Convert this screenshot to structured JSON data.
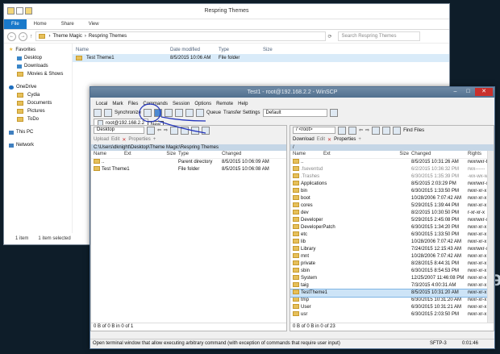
{
  "background": {
    "text_right": "ǝ"
  },
  "explorer": {
    "title": "Respring Themes",
    "tabs": [
      "File",
      "Home",
      "Share",
      "View"
    ],
    "address": {
      "parts": [
        "Theme Magic",
        "Respring Themes"
      ],
      "separator": "›"
    },
    "search_placeholder": "Search Respring Themes",
    "nav": {
      "favorites": "Favorites",
      "fav_items": [
        "Desktop",
        "Downloads",
        "Movies & Shows"
      ],
      "onedrive": "OneDrive",
      "onedrive_items": [
        "Cydia",
        "Documents",
        "Pictures",
        "ToDo"
      ],
      "thispc": "This PC",
      "network": "Network"
    },
    "columns": {
      "name": "Name",
      "date": "Date modified",
      "type": "Type",
      "size": "Size"
    },
    "rows": [
      {
        "name": "Test Theme1",
        "date": "8/5/2015 10:06 AM",
        "type": "File folder",
        "size": ""
      }
    ],
    "status": {
      "count": "1 item",
      "selected": "1 item selected"
    }
  },
  "scp": {
    "title": "Test1 - root@192.168.2.2 - WinSCP",
    "menu": [
      "Local",
      "Mark",
      "Files",
      "Commands",
      "Session",
      "Options",
      "Remote",
      "Help"
    ],
    "toolbar": {
      "sync": "Synchronize",
      "queue": "Queue",
      "transfer_label": "Transfer Settings",
      "transfer_value": "Default"
    },
    "session_tab": "root@192.168.2.2",
    "tooltip": "New",
    "left": {
      "drive": "Desktop",
      "actions": [
        "Upload",
        "Edit",
        "Properties"
      ],
      "path": "C:\\Users\\dknight\\Desktop\\Theme Magic\\Respring Themes",
      "cols": {
        "name": "Name",
        "ext": "Ext",
        "size": "Size",
        "type": "Type",
        "changed": "Changed"
      },
      "rows": [
        {
          "name": "..",
          "size": "",
          "type": "Parent directory",
          "changed": "8/5/2015  10:06:09 AM"
        },
        {
          "name": "Test Theme1",
          "size": "",
          "type": "File folder",
          "changed": "8/5/2015  10:06:08 AM"
        }
      ],
      "footer": "0 B of 0 B in 0 of 1"
    },
    "right": {
      "drive": "/ <root>",
      "actions": [
        "Download",
        "Edit",
        "Properties"
      ],
      "find": "Find Files",
      "path": "/",
      "cols": {
        "name": "Name",
        "ext": "Ext",
        "size": "Size",
        "changed": "Changed",
        "rights": "Rights"
      },
      "rows": [
        {
          "name": "..",
          "changed": "8/5/2015 10:31:26 AM",
          "rights": "rwxrwxr-t",
          "dim": false
        },
        {
          "name": ".fseventsd",
          "changed": "6/2/2015 10:36:32 PM",
          "rights": "rwx------",
          "dim": true
        },
        {
          "name": ".Trashes",
          "changed": "6/30/2015 1:35:39 PM",
          "rights": "-wx-wx-wt",
          "dim": true
        },
        {
          "name": "Applications",
          "changed": "8/5/2015 2:03:29 PM",
          "rights": "rwxrwxr-x",
          "dim": false
        },
        {
          "name": "bin",
          "changed": "6/30/2015 1:33:50 PM",
          "rights": "rwxr-xr-x",
          "dim": false
        },
        {
          "name": "boot",
          "changed": "10/28/2006 7:07:42 AM",
          "rights": "rwxr-xr-x",
          "dim": false
        },
        {
          "name": "cores",
          "changed": "5/29/2015 1:39:44 PM",
          "rights": "rwxr-xr-x",
          "dim": false
        },
        {
          "name": "dev",
          "changed": "8/2/2015 10:30:50 PM",
          "rights": "r-xr-xr-x",
          "dim": false
        },
        {
          "name": "Developer",
          "changed": "5/29/2015 2:45:08 PM",
          "rights": "rwxrwxr-x",
          "dim": false
        },
        {
          "name": "DeveloperPatch",
          "changed": "6/30/2015 1:34:20 PM",
          "rights": "rwxr-xr-x",
          "dim": false
        },
        {
          "name": "etc",
          "changed": "6/30/2015 1:33:50 PM",
          "rights": "rwxr-xr-x",
          "dim": false
        },
        {
          "name": "lib",
          "changed": "10/28/2006 7:07:42 AM",
          "rights": "rwxr-xr-x",
          "dim": false
        },
        {
          "name": "Library",
          "changed": "7/24/2015 12:15:43 AM",
          "rights": "rwxrwxr-x",
          "dim": false
        },
        {
          "name": "mnt",
          "changed": "10/28/2006 7:07:42 AM",
          "rights": "rwxr-xr-x",
          "dim": false
        },
        {
          "name": "private",
          "changed": "8/28/2015 8:44:31 PM",
          "rights": "rwxr-xr-x",
          "dim": false
        },
        {
          "name": "sbin",
          "changed": "6/30/2015 8:54:53 PM",
          "rights": "rwxr-xr-x",
          "dim": false
        },
        {
          "name": "System",
          "changed": "12/25/2007 11:46:08 PM",
          "rights": "rwxr-xr-x",
          "dim": false
        },
        {
          "name": "taig",
          "changed": "7/3/2015 4:00:31 AM",
          "rights": "rwxr-xr-x",
          "dim": false
        },
        {
          "name": "TestTheme1",
          "changed": "8/5/2015 10:31:20 AM",
          "rights": "rwxr-xr-x",
          "dim": false,
          "highlight": true
        },
        {
          "name": "tmp",
          "changed": "6/30/2015 10:31:20 AM",
          "rights": "rwxr-xr-x",
          "dim": false
        },
        {
          "name": "User",
          "changed": "6/30/2015 10:31:21 AM",
          "rights": "rwxr-xr-x",
          "dim": false
        },
        {
          "name": "usr",
          "changed": "6/30/2015 2:03:50 PM",
          "rights": "rwxr-xr-x",
          "dim": false
        }
      ],
      "footer": "0 B of 0 B in 0 of 23"
    },
    "status": {
      "message": "Open terminal window that allow executing arbitrary command (with exception of commands that require user input)",
      "protocol": "SFTP-3",
      "time": "0:01:46"
    }
  },
  "colors": {
    "accent": "#1979ca",
    "annotation": "#2233bb"
  }
}
